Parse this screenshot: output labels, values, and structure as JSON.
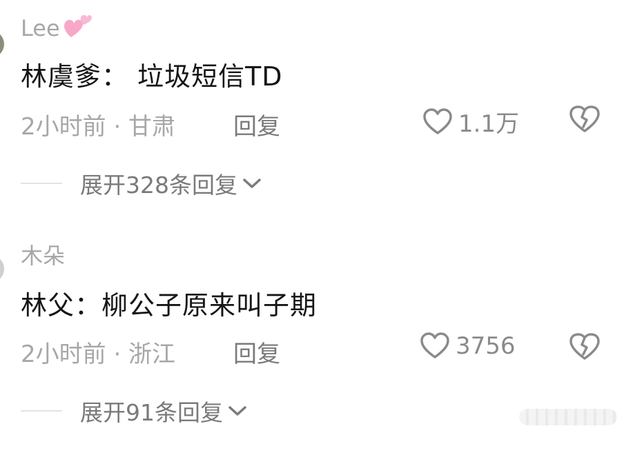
{
  "comments": [
    {
      "username": "Lee",
      "text": "林虞爹：  垃圾短信TD",
      "time_location": "2小时前 · 甘肃",
      "reply_label": "回复",
      "like_count": "1.1万",
      "expand_label": "展开328条回复"
    },
    {
      "username": "木朵",
      "text": "林父：柳公子原来叫子期",
      "time_location": "2小时前 · 浙江",
      "reply_label": "回复",
      "like_count": "3756",
      "expand_label": "展开91条回复"
    }
  ],
  "icons": {
    "username_emoji": "pink-hearts-icon",
    "like": "heart-outline-icon",
    "dislike": "broken-heart-icon",
    "expand": "chevron-down-icon"
  },
  "colors": {
    "text": "#161616",
    "muted": "#a7a7a7",
    "icon": "#8a8a8a",
    "emoji_pink": "#f7a8c8"
  }
}
